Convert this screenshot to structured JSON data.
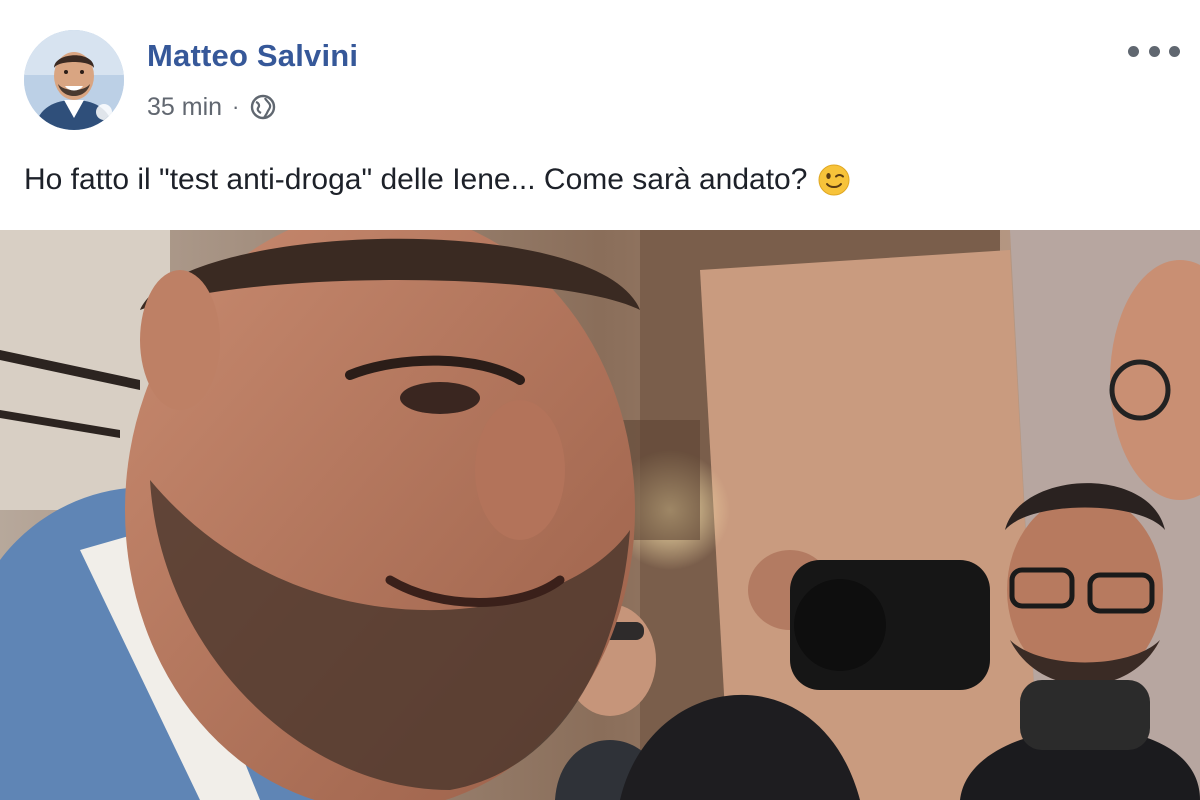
{
  "post": {
    "author_name": "Matteo Salvini",
    "timestamp": "35 min",
    "separator": "·",
    "privacy_icon": "globe-icon",
    "more_icon": "more-options-icon",
    "text": "Ho fatto il \"test anti-droga\" delle Iene... Come sarà andato?",
    "emoji": "winking-face-emoji"
  },
  "media": {
    "type": "video",
    "description_icon": "video-thumbnail"
  },
  "colors": {
    "author_link": "#365899",
    "meta_text": "#616770",
    "body_text": "#1d2129"
  }
}
